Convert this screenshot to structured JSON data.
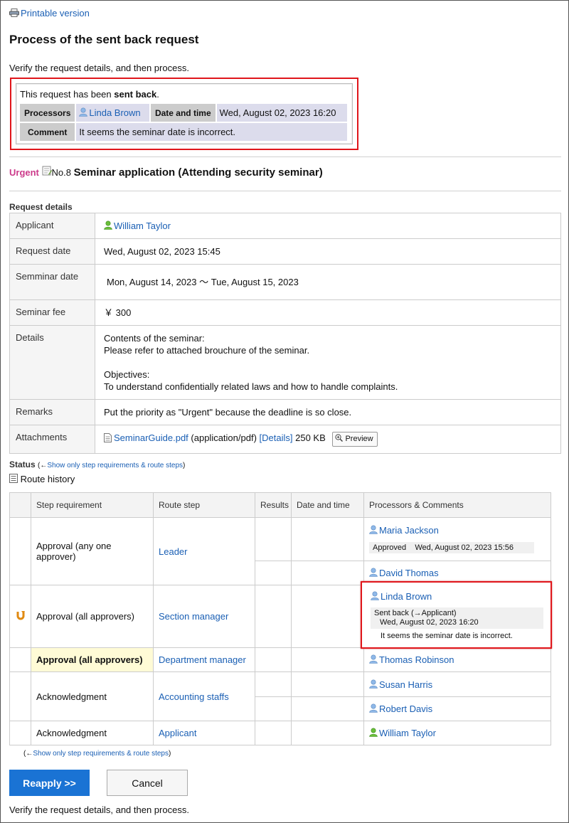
{
  "printable_link": "Printable version",
  "title": "Process of the sent back request",
  "verify_text": "Verify the request details, and then process.",
  "sent_back": {
    "message_prefix": "This request has been ",
    "message_bold": "sent back",
    "message_suffix": ".",
    "processors_label": "Processors",
    "processor_name": "Linda Brown",
    "datetime_label": "Date and time",
    "datetime_value": "Wed, August 02, 2023 16:20",
    "comment_label": "Comment",
    "comment_value": "It seems the seminar date is incorrect."
  },
  "request": {
    "urgent": "Urgent",
    "number": "No.8",
    "name": "Seminar application (Attending security seminar)"
  },
  "details": {
    "section_label": "Request details",
    "applicant_label": "Applicant",
    "applicant_value": "William Taylor",
    "request_date_label": "Request date",
    "request_date_value": "Wed, August 02, 2023 15:45",
    "seminar_date_label": "Semminar date",
    "seminar_date_value": "Mon, August 14, 2023 〜 Tue, August 15, 2023",
    "seminar_fee_label": "Seminar fee",
    "seminar_fee_value": "￥ 300",
    "details_label": "Details",
    "details_line1": "Contents of the seminar:",
    "details_line2": "Please refer to attached brouchure of the seminar.",
    "details_line3": "Objectives:",
    "details_line4": "To understand confidentially related laws and how to handle complaints.",
    "remarks_label": "Remarks",
    "remarks_value": "Put the priority as \"Urgent\" because the deadline is so close.",
    "attachments_label": "Attachments",
    "attachment_file": "SeminarGuide.pdf",
    "attachment_type": "(application/pdf)",
    "attachment_details": "[Details]",
    "attachment_size": "250 KB",
    "preview_label": "Preview"
  },
  "status": {
    "label": "Status",
    "toggle_prefix": "(←",
    "toggle_link": "Show only step requirements & route steps",
    "toggle_suffix": ")",
    "route_history": "Route history"
  },
  "route_table": {
    "headers": [
      "Step requirement",
      "Route step",
      "Results",
      "Date and time",
      "Processors & Comments"
    ],
    "rows": [
      {
        "requirement": "Approval (any one approver)",
        "step": "Leader",
        "processors": [
          "Maria Jackson",
          "David Thomas"
        ],
        "status_result": "Approved",
        "status_date": "Wed, August 02, 2023 15:56"
      },
      {
        "requirement": "Approval (all approvers)",
        "step": "Section manager",
        "processors": [
          "Linda Brown"
        ],
        "status_result": "Sent back (→Applicant)",
        "status_date": "Wed, August 02, 2023 16:20",
        "comment": "It seems the seminar date is incorrect."
      },
      {
        "requirement": "Approval (all approvers)",
        "step": "Department manager",
        "processors": [
          "Thomas Robinson"
        ]
      },
      {
        "requirement": "Acknowledgment",
        "step": "Accounting staffs",
        "processors": [
          "Susan Harris",
          "Robert Davis"
        ]
      },
      {
        "requirement": "Acknowledgment",
        "step": "Applicant",
        "processors": [
          "William Taylor"
        ]
      }
    ]
  },
  "buttons": {
    "reapply": "Reapply >>",
    "cancel": "Cancel"
  },
  "colors": {
    "link": "#1a5fb4",
    "urgent": "#cc3a8a",
    "highlight_border": "#e0161b",
    "primary_button": "#1a73d4",
    "current_step_bg": "#fffbd6"
  }
}
